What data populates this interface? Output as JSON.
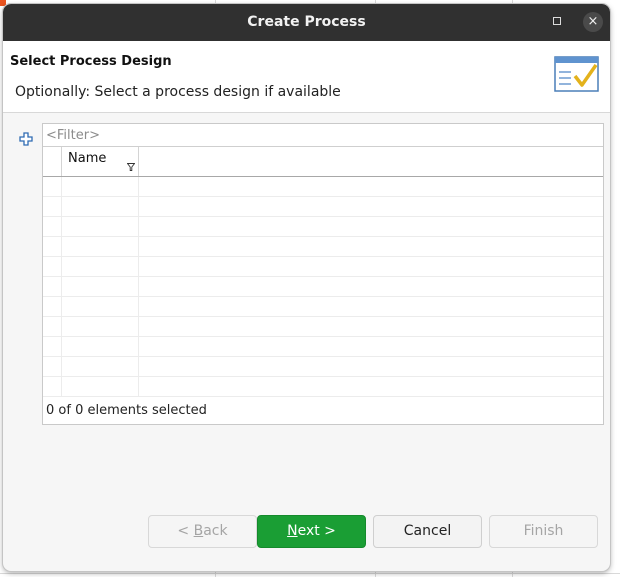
{
  "window": {
    "title": "Create Process",
    "close_glyph": "×"
  },
  "header": {
    "title": "Select Process Design",
    "subtitle": "Optionally: Select a process design if available",
    "image": "wizard-checklist-icon"
  },
  "filter": {
    "placeholder": "<Filter>",
    "value": ""
  },
  "table": {
    "columns": [
      "",
      "Name"
    ],
    "rows": [],
    "empty_row_count": 11
  },
  "status": {
    "text": "0 of 0 elements selected"
  },
  "buttons": {
    "back": {
      "prefix": "< ",
      "mnemonic": "B",
      "rest": "ack",
      "enabled": false
    },
    "next": {
      "mnemonic": "N",
      "rest": "ext >",
      "enabled": true
    },
    "cancel": {
      "label": "Cancel",
      "enabled": true
    },
    "finish": {
      "label": "Finish",
      "enabled": false
    }
  },
  "colors": {
    "titlebar": "#303030",
    "primary_button": "#1a9e34",
    "accent_orange": "#e95420"
  }
}
